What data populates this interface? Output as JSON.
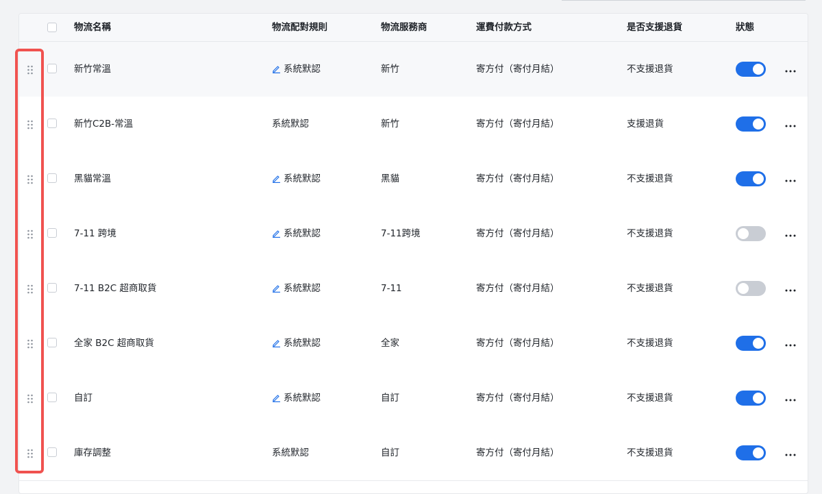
{
  "header": {
    "logistics_name": "物流名稱",
    "matching_rule": "物流配對規則",
    "provider": "物流服務商",
    "freight_payment": "運費付款方式",
    "return_support": "是否支援退貨",
    "status": "狀態"
  },
  "rows": [
    {
      "name": "新竹常溫",
      "rule": "系統默認",
      "rule_editable": true,
      "provider": "新竹",
      "payment": "寄方付（寄付月結）",
      "returns": "不支援退貨",
      "enabled": true
    },
    {
      "name": "新竹C2B-常溫",
      "rule": "系統默認",
      "rule_editable": false,
      "provider": "新竹",
      "payment": "寄方付（寄付月結）",
      "returns": "支援退貨",
      "enabled": true
    },
    {
      "name": "黑貓常溫",
      "rule": "系統默認",
      "rule_editable": true,
      "provider": "黑貓",
      "payment": "寄方付（寄付月結）",
      "returns": "不支援退貨",
      "enabled": true
    },
    {
      "name": "7-11 跨境",
      "rule": "系統默認",
      "rule_editable": true,
      "provider": "7-11跨境",
      "payment": "寄方付（寄付月結）",
      "returns": "不支援退貨",
      "enabled": false
    },
    {
      "name": "7-11 B2C 超商取貨",
      "rule": "系統默認",
      "rule_editable": true,
      "provider": "7-11",
      "payment": "寄方付（寄付月結）",
      "returns": "不支援退貨",
      "enabled": false
    },
    {
      "name": "全家 B2C 超商取貨",
      "rule": "系統默認",
      "rule_editable": true,
      "provider": "全家",
      "payment": "寄方付（寄付月結）",
      "returns": "不支援退貨",
      "enabled": true
    },
    {
      "name": "自訂",
      "rule": "系統默認",
      "rule_editable": true,
      "provider": "自訂",
      "payment": "寄方付（寄付月結）",
      "returns": "不支援退貨",
      "enabled": true
    },
    {
      "name": "庫存調整",
      "rule": "系統默認",
      "rule_editable": false,
      "provider": "自訂",
      "payment": "寄方付（寄付月結）",
      "returns": "不支援退貨",
      "enabled": true
    }
  ],
  "icons": {
    "drag": "drag-handle-icon",
    "edit": "pencil-icon",
    "more": "more-horizontal-icon"
  },
  "colors": {
    "toggle_on": "#1f6fe8",
    "toggle_off": "#c9cdd4",
    "highlight": "#f0524f",
    "edit_icon": "#1f6fe8"
  }
}
